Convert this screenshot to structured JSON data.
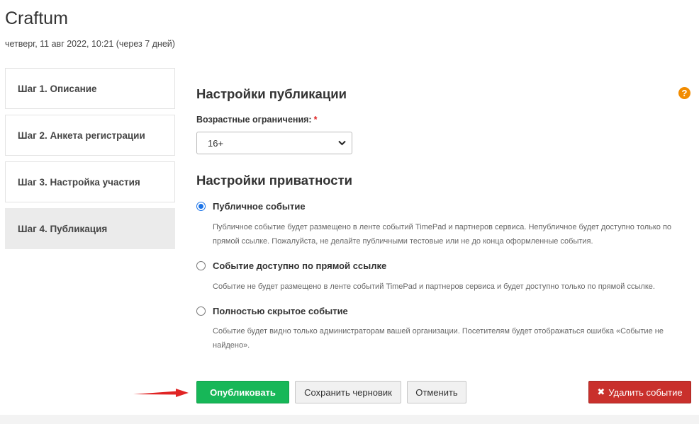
{
  "event": {
    "title": "Craftum",
    "date": "четверг, 11 авг 2022, 10:21 (через 7 дней)"
  },
  "steps": [
    {
      "label": "Шаг 1. Описание",
      "active": false
    },
    {
      "label": "Шаг 2. Анкета регистрации",
      "active": false
    },
    {
      "label": "Шаг 3. Настройка участия",
      "active": false
    },
    {
      "label": "Шаг 4. Публикация",
      "active": true
    }
  ],
  "publication": {
    "title": "Настройки публикации",
    "help_icon": "?",
    "age_label": "Возрастные ограничения:",
    "required_mark": "*",
    "age_value": "16+"
  },
  "privacy": {
    "title": "Настройки приватности",
    "options": [
      {
        "label": "Публичное событие",
        "desc": "Публичное событие будет размещено в ленте событий TimePad и партнеров сервиса. Непубличное будет доступно только по прямой ссылке. Пожалуйста, не делайте публичными тестовые или не до конца оформленные события.",
        "checked": true
      },
      {
        "label": "Событие доступно по прямой ссылке",
        "desc": "Событие не будет размещено в ленте событий TimePad и партнеров сервиса и будет доступно только по прямой ссылке.",
        "checked": false
      },
      {
        "label": "Полностью скрытое событие",
        "desc": "Событие будет видно только администраторам вашей организации. Посетителям будет отображаться ошибка «Событие не найдено».",
        "checked": false
      }
    ]
  },
  "actions": {
    "publish": "Опубликовать",
    "save_draft": "Сохранить черновик",
    "cancel": "Отменить",
    "delete_icon": "✖",
    "delete": "Удалить событие"
  },
  "colors": {
    "publish": "#17b758",
    "delete": "#c9302c",
    "help": "#f28c00",
    "arrow": "#e02424",
    "radio_checked": "#1a73e8"
  }
}
